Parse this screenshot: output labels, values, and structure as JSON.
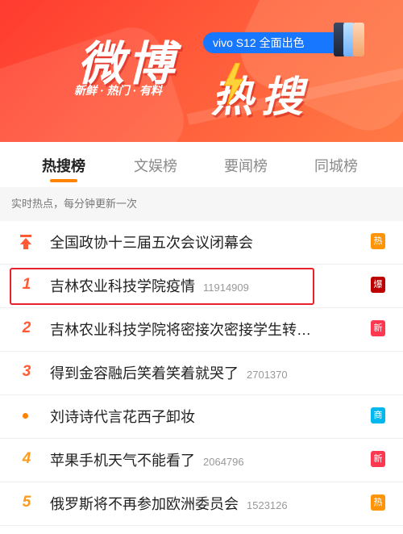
{
  "banner": {
    "logo_weibo": "微博",
    "logo_resou": "热搜",
    "tagline": "新鲜 · 热门 · 有料",
    "sponsor": "vivo S12 全面出色",
    "colors": {
      "bg": "#ff4433",
      "sponsor": "#1877ff"
    }
  },
  "tabs": [
    {
      "label": "热搜榜",
      "active": true
    },
    {
      "label": "文娱榜",
      "active": false
    },
    {
      "label": "要闻榜",
      "active": false
    },
    {
      "label": "同城榜",
      "active": false
    }
  ],
  "subhead": "实时热点，每分钟更新一次",
  "items": [
    {
      "rank_icon": "pin-icon",
      "rank": "",
      "title": "全国政协十三届五次会议闭幕会",
      "count": "",
      "badge": "热",
      "badge_color": "#ff9406"
    },
    {
      "rank": "1",
      "title": "吉林农业科技学院疫情",
      "count": "11914909",
      "badge": "爆",
      "badge_color": "#bd0000"
    },
    {
      "rank": "2",
      "title": "吉林农业科技学院将密接次密接学生转…",
      "count": "",
      "badge": "新",
      "badge_color": "#ff3852"
    },
    {
      "rank": "3",
      "title": "得到金容融后笑着笑着就哭了",
      "count": "2701370",
      "badge": "",
      "badge_color": ""
    },
    {
      "rank_icon": "dot-icon",
      "rank": "",
      "title": "刘诗诗代言花西子卸妆",
      "count": "",
      "badge": "商",
      "badge_color": "#00b7ee"
    },
    {
      "rank": "4",
      "title": "苹果手机天气不能看了",
      "count": "2064796",
      "badge": "新",
      "badge_color": "#ff3852"
    },
    {
      "rank": "5",
      "title": "俄罗斯将不再参加欧洲委员会",
      "count": "1523126",
      "badge": "热",
      "badge_color": "#ff9406"
    }
  ]
}
